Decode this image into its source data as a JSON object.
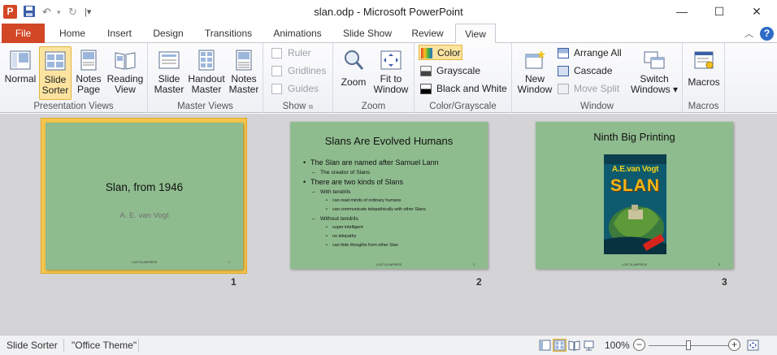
{
  "titlebar": {
    "title": "slan.odp - Microsoft PowerPoint",
    "app_icon_letter": "P",
    "minimize": "—",
    "maximize": "☐",
    "close": "✕"
  },
  "ribbon_tabs": [
    "File",
    "Home",
    "Insert",
    "Design",
    "Transitions",
    "Animations",
    "Slide Show",
    "Review",
    "View"
  ],
  "active_tab": "View",
  "ribbon": {
    "presentation_views": {
      "label": "Presentation Views",
      "normal": "Normal",
      "slide_sorter_1": "Slide",
      "slide_sorter_2": "Sorter",
      "notes_page_1": "Notes",
      "notes_page_2": "Page",
      "reading_view_1": "Reading",
      "reading_view_2": "View"
    },
    "master_views": {
      "label": "Master Views",
      "slide_master_1": "Slide",
      "slide_master_2": "Master",
      "handout_master_1": "Handout",
      "handout_master_2": "Master",
      "notes_master_1": "Notes",
      "notes_master_2": "Master"
    },
    "show": {
      "label": "Show",
      "ruler": "Ruler",
      "gridlines": "Gridlines",
      "guides": "Guides"
    },
    "zoom": {
      "label": "Zoom",
      "zoom": "Zoom",
      "fit_1": "Fit to",
      "fit_2": "Window"
    },
    "color_grayscale": {
      "label": "Color/Grayscale",
      "color": "Color",
      "grayscale": "Grayscale",
      "bw": "Black and White"
    },
    "window": {
      "label": "Window",
      "new_window_1": "New",
      "new_window_2": "Window",
      "arrange_all": "Arrange All",
      "cascade": "Cascade",
      "move_split": "Move Split",
      "switch_1": "Switch",
      "switch_2": "Windows ▾"
    },
    "macros": {
      "label": "Macros",
      "macros": "Macros"
    }
  },
  "slides": [
    {
      "number": "1",
      "title": "Slan, from 1946",
      "subtitle": "A. E. van Vogt",
      "footer": "LOST SLANPRESS",
      "page": "1"
    },
    {
      "number": "2",
      "title": "Slans Are Evolved Humans",
      "bullets": [
        "The Slan are named after Samuel Lann",
        "The creator  of Slans",
        "There are two kinds of Slans",
        "With tendrils",
        "can read minds of ordinary humans",
        "can communicate telepathically with other Slans",
        "Without tendrils",
        "super intelligent",
        "no telepathy",
        "can hide thoughts from other Slan"
      ],
      "footer": "LOST SLANPRESS",
      "page": "2"
    },
    {
      "number": "3",
      "title": "Ninth Big Printing",
      "cover_author": "A.E.van Vogt",
      "cover_title": "SLAN",
      "footer": "LOST SLANPRESS",
      "page": "3"
    }
  ],
  "statusbar": {
    "view_name": "Slide Sorter",
    "theme": "\"Office Theme\"",
    "zoom": "100%",
    "zoom_level": 0.5
  },
  "colors": {
    "file_tab": "#d24726",
    "slide_bg": "#8fbc8f",
    "selection": "#f5c64c",
    "workspace": "#d4d4d6"
  }
}
